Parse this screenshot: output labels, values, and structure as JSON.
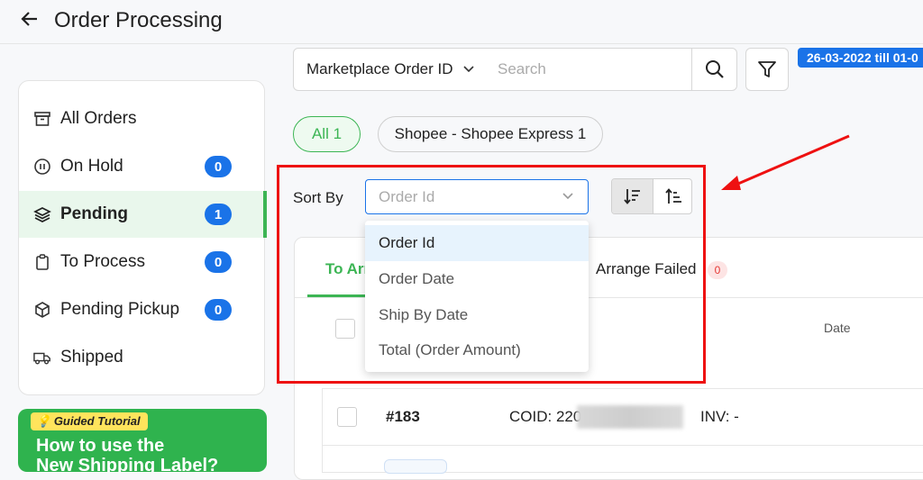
{
  "header": {
    "title": "Order Processing",
    "back_icon": "arrow-left-icon"
  },
  "sidebar": {
    "items": [
      {
        "label": "All Orders",
        "icon": "archive-box-icon"
      },
      {
        "label": "On Hold",
        "icon": "pause-circle-icon",
        "count": "0"
      },
      {
        "label": "Pending",
        "icon": "layers-icon",
        "count": "1",
        "active": true
      },
      {
        "label": "To Process",
        "icon": "clipboard-icon",
        "count": "0"
      },
      {
        "label": "Pending Pickup",
        "icon": "package-icon",
        "count": "0"
      },
      {
        "label": "Shipped",
        "icon": "truck-icon"
      }
    ]
  },
  "promo": {
    "tag": "Guided Tutorial",
    "text_line1": "How to use the",
    "text_line2": "New Shipping Label?"
  },
  "search": {
    "field_selector": "Marketplace Order ID",
    "placeholder": "Search"
  },
  "date_range": "26-03-2022 till 01-0",
  "filters": {
    "all": "All 1",
    "shopee": "Shopee - Shopee Express 1"
  },
  "sort": {
    "label": "Sort By",
    "placeholder": "Order Id",
    "options": [
      "Order Id",
      "Order Date",
      "Ship By Date",
      "Total (Order Amount)"
    ],
    "selected_index": 0
  },
  "tabs": {
    "to_arrange": "To Arr",
    "arrange_failed": "Arrange Failed",
    "arrange_failed_count": "0"
  },
  "table": {
    "date_header": "Date",
    "rows": [
      {
        "order_id": "#183",
        "cod": "COID: 220",
        "inv": "INV: -"
      }
    ]
  },
  "colors": {
    "accent_green": "#3cb554",
    "badge_blue": "#1a73e8",
    "annotation_red": "#e11111"
  }
}
